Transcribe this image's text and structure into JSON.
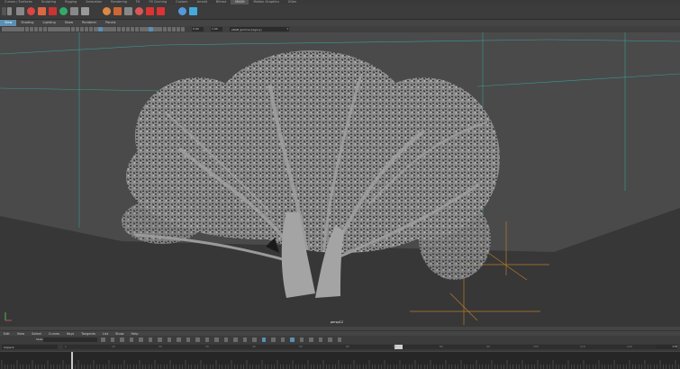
{
  "shelf": {
    "tabs": [
      "Curves / Surfaces",
      "Sculpting",
      "Rigging",
      "Animation",
      "Rendering",
      "FX",
      "FX Caching",
      "Custom",
      "Arnold",
      "Bifrost",
      "MASH",
      "Motion Graphics",
      "XGen"
    ],
    "active_tab": 10,
    "icons": [
      "menu-icon",
      "move-tool-icon",
      "rotate-tool-icon",
      "paint-tool-icon",
      "sculpt-icon",
      "select-icon",
      "texture-icon",
      "type-tool-icon",
      "image-plane-icon",
      "curve-icon",
      "sphere-icon",
      "network-icon",
      "fill-icon",
      "deform-icon",
      "export-icon"
    ]
  },
  "panel_menu": {
    "items": [
      "View",
      "Shading",
      "Lighting",
      "Show",
      "Renderer",
      "Panels"
    ],
    "active": 0
  },
  "panel_toolbar": {
    "exposure": "0.00",
    "gamma": "1.00",
    "colorspace": "sRGB gamma (legacy)"
  },
  "viewport": {
    "camera_label": "persp12",
    "background": "#4a4a4a",
    "grid_color": "#3a9c90",
    "floor_color": "#373737"
  },
  "menu_strip": {
    "items": [
      "Edit",
      "View",
      "Select",
      "Curves",
      "Keys",
      "Tangents",
      "List",
      "Show",
      "Help"
    ]
  },
  "anim": {
    "stats_label": "Stats",
    "set_label": "Sixpack"
  },
  "range": {
    "ticks": [
      "1",
      "10",
      "20",
      "30",
      "40",
      "50",
      "60",
      "70",
      "80",
      "90",
      "100",
      "110",
      "120"
    ],
    "current_frame": "176"
  },
  "timeline": {
    "playhead_frame": 77
  }
}
